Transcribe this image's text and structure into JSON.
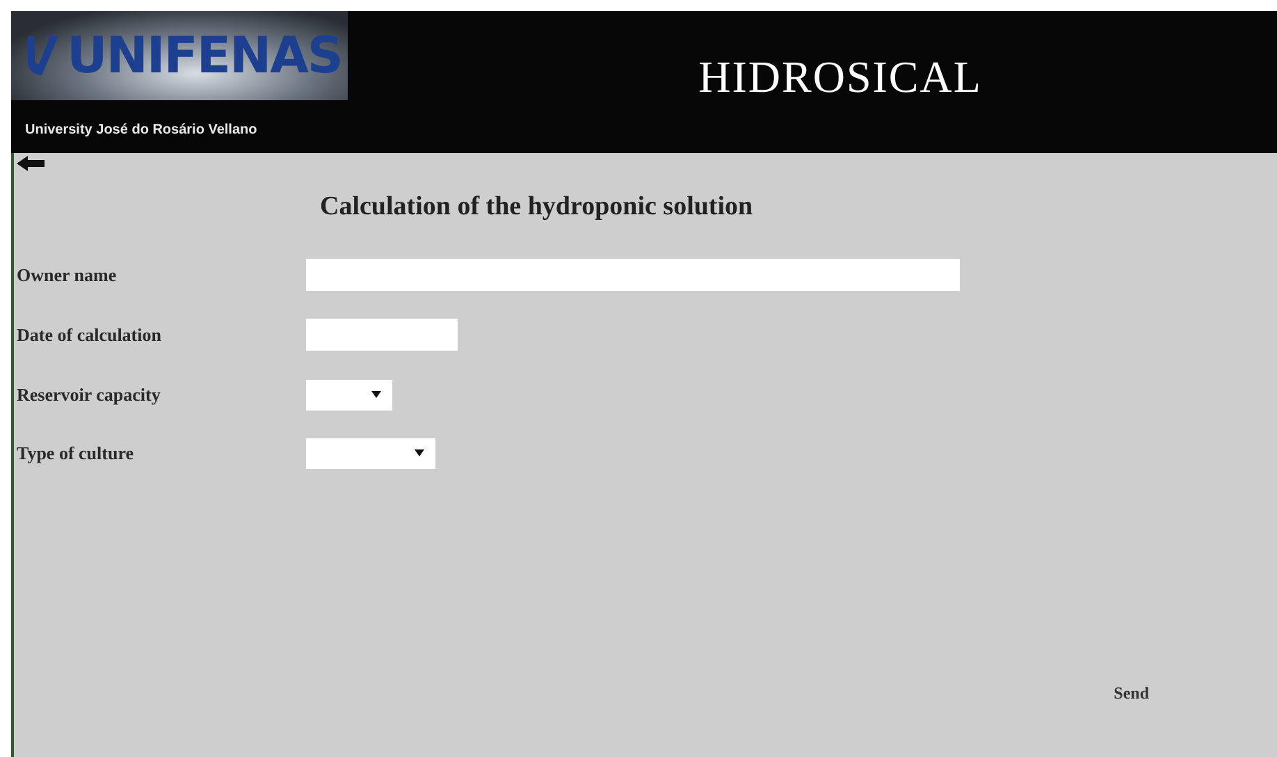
{
  "header": {
    "logo_text": "UNIFENAS",
    "logo_subtitle": "University José do Rosário Vellano",
    "app_title": "HIDROSICAL"
  },
  "form": {
    "title": "Calculation of the hydroponic solution",
    "fields": [
      {
        "label": "Owner name",
        "kind": "text"
      },
      {
        "label": "Date of calculation",
        "kind": "text"
      },
      {
        "label": "Reservoir capacity",
        "kind": "select"
      },
      {
        "label": "Type of culture",
        "kind": "select"
      }
    ],
    "submit": "Send"
  }
}
